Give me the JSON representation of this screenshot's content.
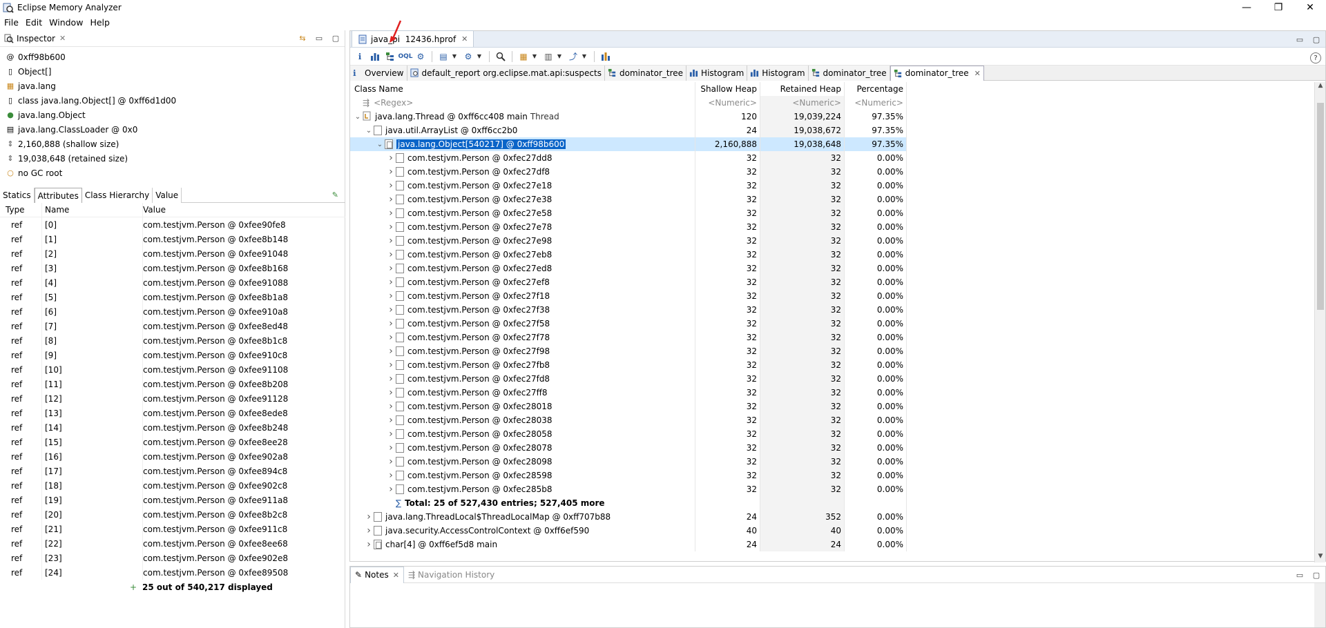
{
  "window": {
    "title": "Eclipse Memory Analyzer",
    "controls": [
      "—",
      "❐",
      "✕"
    ]
  },
  "menu": [
    "File",
    "Edit",
    "Window",
    "Help"
  ],
  "inspector": {
    "tab_label": "Inspector",
    "info": [
      {
        "icon": "at-icon",
        "glyph": "@",
        "text": "0xff98b600"
      },
      {
        "icon": "array-class-icon",
        "glyph": "▯",
        "text": "Object[]"
      },
      {
        "icon": "package-icon",
        "glyph": "▦",
        "text": "java.lang"
      },
      {
        "icon": "class-icon",
        "glyph": "▯",
        "text": "class java.lang.Object[] @ 0xff6d1d00"
      },
      {
        "icon": "superclass-icon",
        "glyph": "●",
        "text": "java.lang.Object"
      },
      {
        "icon": "classloader-icon",
        "glyph": "▤",
        "text": "java.lang.ClassLoader @ 0x0"
      },
      {
        "icon": "shallow-size-icon",
        "glyph": "⇕",
        "text": "2,160,888 (shallow size)"
      },
      {
        "icon": "retained-size-icon",
        "glyph": "⇕",
        "text": "19,038,648 (retained size)"
      },
      {
        "icon": "gc-root-icon",
        "glyph": "○",
        "text": "no GC root"
      }
    ],
    "tabs": [
      "Statics",
      "Attributes",
      "Class Hierarchy",
      "Value"
    ],
    "active_tab": "Attributes",
    "columns": [
      "Type",
      "Name",
      "Value"
    ],
    "rows": [
      {
        "type": "ref",
        "name": "[0]",
        "value": "com.testjvm.Person @ 0xfee90fe8"
      },
      {
        "type": "ref",
        "name": "[1]",
        "value": "com.testjvm.Person @ 0xfee8b148"
      },
      {
        "type": "ref",
        "name": "[2]",
        "value": "com.testjvm.Person @ 0xfee91048"
      },
      {
        "type": "ref",
        "name": "[3]",
        "value": "com.testjvm.Person @ 0xfee8b168"
      },
      {
        "type": "ref",
        "name": "[4]",
        "value": "com.testjvm.Person @ 0xfee91088"
      },
      {
        "type": "ref",
        "name": "[5]",
        "value": "com.testjvm.Person @ 0xfee8b1a8"
      },
      {
        "type": "ref",
        "name": "[6]",
        "value": "com.testjvm.Person @ 0xfee910a8"
      },
      {
        "type": "ref",
        "name": "[7]",
        "value": "com.testjvm.Person @ 0xfee8ed48"
      },
      {
        "type": "ref",
        "name": "[8]",
        "value": "com.testjvm.Person @ 0xfee8b1c8"
      },
      {
        "type": "ref",
        "name": "[9]",
        "value": "com.testjvm.Person @ 0xfee910c8"
      },
      {
        "type": "ref",
        "name": "[10]",
        "value": "com.testjvm.Person @ 0xfee91108"
      },
      {
        "type": "ref",
        "name": "[11]",
        "value": "com.testjvm.Person @ 0xfee8b208"
      },
      {
        "type": "ref",
        "name": "[12]",
        "value": "com.testjvm.Person @ 0xfee91128"
      },
      {
        "type": "ref",
        "name": "[13]",
        "value": "com.testjvm.Person @ 0xfee8ede8"
      },
      {
        "type": "ref",
        "name": "[14]",
        "value": "com.testjvm.Person @ 0xfee8b248"
      },
      {
        "type": "ref",
        "name": "[15]",
        "value": "com.testjvm.Person @ 0xfee8ee28"
      },
      {
        "type": "ref",
        "name": "[16]",
        "value": "com.testjvm.Person @ 0xfee902a8"
      },
      {
        "type": "ref",
        "name": "[17]",
        "value": "com.testjvm.Person @ 0xfee894c8"
      },
      {
        "type": "ref",
        "name": "[18]",
        "value": "com.testjvm.Person @ 0xfee902c8"
      },
      {
        "type": "ref",
        "name": "[19]",
        "value": "com.testjvm.Person @ 0xfee911a8"
      },
      {
        "type": "ref",
        "name": "[20]",
        "value": "com.testjvm.Person @ 0xfee8b2c8"
      },
      {
        "type": "ref",
        "name": "[21]",
        "value": "com.testjvm.Person @ 0xfee911c8"
      },
      {
        "type": "ref",
        "name": "[22]",
        "value": "com.testjvm.Person @ 0xfee8ee68"
      },
      {
        "type": "ref",
        "name": "[23]",
        "value": "com.testjvm.Person @ 0xfee902e8"
      },
      {
        "type": "ref",
        "name": "[24]",
        "value": "com.testjvm.Person @ 0xfee89508"
      }
    ],
    "footer": "25 out of 540,217 displayed"
  },
  "editor": {
    "tab_label": "java_pi  12436.hprof",
    "query_tabs": [
      {
        "label": "Overview",
        "icon": "info-icon"
      },
      {
        "label": "default_report  org.eclipse.mat.api:suspects",
        "icon": "report-icon"
      },
      {
        "label": "dominator_tree",
        "icon": "dominator-tree-icon"
      },
      {
        "label": "Histogram",
        "icon": "histogram-icon"
      },
      {
        "label": "Histogram",
        "icon": "histogram-icon"
      },
      {
        "label": "dominator_tree",
        "icon": "dominator-tree-icon"
      },
      {
        "label": "dominator_tree",
        "icon": "dominator-tree-icon",
        "active": true
      }
    ],
    "columns": {
      "name": "Class Name",
      "shallow": "Shallow Heap",
      "retained": "Retained Heap",
      "pct": "Percentage"
    },
    "filters": {
      "name": "<Regex>",
      "shallow": "<Numeric>",
      "retained": "<Numeric>",
      "pct": "<Numeric>"
    },
    "rows": [
      {
        "level": 0,
        "expand": "open",
        "icon": "thread",
        "name": "java.lang.Thread @ 0xff6cc408  main",
        "extra": "Thread",
        "shallow": "120",
        "retained": "19,039,224",
        "pct": "97.35%"
      },
      {
        "level": 1,
        "expand": "open",
        "icon": "obj",
        "name": "java.util.ArrayList @ 0xff6cc2b0",
        "shallow": "24",
        "retained": "19,038,672",
        "pct": "97.35%"
      },
      {
        "level": 2,
        "expand": "open",
        "icon": "arr",
        "name": "java.lang.Object[540217] @ 0xff98b600",
        "shallow": "2,160,888",
        "retained": "19,038,648",
        "pct": "97.35%",
        "selected": true
      },
      {
        "level": 3,
        "expand": "closed",
        "icon": "obj",
        "name": "com.testjvm.Person @ 0xfec27dd8",
        "shallow": "32",
        "retained": "32",
        "pct": "0.00%"
      },
      {
        "level": 3,
        "expand": "closed",
        "icon": "obj",
        "name": "com.testjvm.Person @ 0xfec27df8",
        "shallow": "32",
        "retained": "32",
        "pct": "0.00%"
      },
      {
        "level": 3,
        "expand": "closed",
        "icon": "obj",
        "name": "com.testjvm.Person @ 0xfec27e18",
        "shallow": "32",
        "retained": "32",
        "pct": "0.00%"
      },
      {
        "level": 3,
        "expand": "closed",
        "icon": "obj",
        "name": "com.testjvm.Person @ 0xfec27e38",
        "shallow": "32",
        "retained": "32",
        "pct": "0.00%"
      },
      {
        "level": 3,
        "expand": "closed",
        "icon": "obj",
        "name": "com.testjvm.Person @ 0xfec27e58",
        "shallow": "32",
        "retained": "32",
        "pct": "0.00%"
      },
      {
        "level": 3,
        "expand": "closed",
        "icon": "obj",
        "name": "com.testjvm.Person @ 0xfec27e78",
        "shallow": "32",
        "retained": "32",
        "pct": "0.00%"
      },
      {
        "level": 3,
        "expand": "closed",
        "icon": "obj",
        "name": "com.testjvm.Person @ 0xfec27e98",
        "shallow": "32",
        "retained": "32",
        "pct": "0.00%"
      },
      {
        "level": 3,
        "expand": "closed",
        "icon": "obj",
        "name": "com.testjvm.Person @ 0xfec27eb8",
        "shallow": "32",
        "retained": "32",
        "pct": "0.00%"
      },
      {
        "level": 3,
        "expand": "closed",
        "icon": "obj",
        "name": "com.testjvm.Person @ 0xfec27ed8",
        "shallow": "32",
        "retained": "32",
        "pct": "0.00%"
      },
      {
        "level": 3,
        "expand": "closed",
        "icon": "obj",
        "name": "com.testjvm.Person @ 0xfec27ef8",
        "shallow": "32",
        "retained": "32",
        "pct": "0.00%"
      },
      {
        "level": 3,
        "expand": "closed",
        "icon": "obj",
        "name": "com.testjvm.Person @ 0xfec27f18",
        "shallow": "32",
        "retained": "32",
        "pct": "0.00%"
      },
      {
        "level": 3,
        "expand": "closed",
        "icon": "obj",
        "name": "com.testjvm.Person @ 0xfec27f38",
        "shallow": "32",
        "retained": "32",
        "pct": "0.00%"
      },
      {
        "level": 3,
        "expand": "closed",
        "icon": "obj",
        "name": "com.testjvm.Person @ 0xfec27f58",
        "shallow": "32",
        "retained": "32",
        "pct": "0.00%"
      },
      {
        "level": 3,
        "expand": "closed",
        "icon": "obj",
        "name": "com.testjvm.Person @ 0xfec27f78",
        "shallow": "32",
        "retained": "32",
        "pct": "0.00%"
      },
      {
        "level": 3,
        "expand": "closed",
        "icon": "obj",
        "name": "com.testjvm.Person @ 0xfec27f98",
        "shallow": "32",
        "retained": "32",
        "pct": "0.00%"
      },
      {
        "level": 3,
        "expand": "closed",
        "icon": "obj",
        "name": "com.testjvm.Person @ 0xfec27fb8",
        "shallow": "32",
        "retained": "32",
        "pct": "0.00%"
      },
      {
        "level": 3,
        "expand": "closed",
        "icon": "obj",
        "name": "com.testjvm.Person @ 0xfec27fd8",
        "shallow": "32",
        "retained": "32",
        "pct": "0.00%"
      },
      {
        "level": 3,
        "expand": "closed",
        "icon": "obj",
        "name": "com.testjvm.Person @ 0xfec27ff8",
        "shallow": "32",
        "retained": "32",
        "pct": "0.00%"
      },
      {
        "level": 3,
        "expand": "closed",
        "icon": "obj",
        "name": "com.testjvm.Person @ 0xfec28018",
        "shallow": "32",
        "retained": "32",
        "pct": "0.00%"
      },
      {
        "level": 3,
        "expand": "closed",
        "icon": "obj",
        "name": "com.testjvm.Person @ 0xfec28038",
        "shallow": "32",
        "retained": "32",
        "pct": "0.00%"
      },
      {
        "level": 3,
        "expand": "closed",
        "icon": "obj",
        "name": "com.testjvm.Person @ 0xfec28058",
        "shallow": "32",
        "retained": "32",
        "pct": "0.00%"
      },
      {
        "level": 3,
        "expand": "closed",
        "icon": "obj",
        "name": "com.testjvm.Person @ 0xfec28078",
        "shallow": "32",
        "retained": "32",
        "pct": "0.00%"
      },
      {
        "level": 3,
        "expand": "closed",
        "icon": "obj",
        "name": "com.testjvm.Person @ 0xfec28098",
        "shallow": "32",
        "retained": "32",
        "pct": "0.00%"
      },
      {
        "level": 3,
        "expand": "closed",
        "icon": "obj",
        "name": "com.testjvm.Person @ 0xfec28598",
        "shallow": "32",
        "retained": "32",
        "pct": "0.00%"
      },
      {
        "level": 3,
        "expand": "closed",
        "icon": "obj",
        "name": "com.testjvm.Person @ 0xfec285b8",
        "shallow": "32",
        "retained": "32",
        "pct": "0.00%"
      },
      {
        "level": 3,
        "expand": "none",
        "icon": "sum",
        "name": "Total: 25 of 527,430 entries; 527,405 more",
        "shallow": "",
        "retained": "",
        "pct": "",
        "bold": true
      },
      {
        "level": 1,
        "expand": "closed",
        "icon": "obj",
        "name": "java.lang.ThreadLocal$ThreadLocalMap @ 0xff707b88",
        "shallow": "24",
        "retained": "352",
        "pct": "0.00%"
      },
      {
        "level": 1,
        "expand": "closed",
        "icon": "obj",
        "name": "java.security.AccessControlContext @ 0xff6ef590",
        "shallow": "40",
        "retained": "40",
        "pct": "0.00%"
      },
      {
        "level": 1,
        "expand": "closed",
        "icon": "arr",
        "name": "char[4] @ 0xff6ef5d8  main",
        "shallow": "24",
        "retained": "24",
        "pct": "0.00%"
      }
    ]
  },
  "notes": {
    "tabs": [
      "Notes",
      "Navigation History"
    ]
  },
  "colors": {
    "selection": "#0a64c8",
    "selection_row": "#cde8ff",
    "annotation_arrow": "#e02020"
  }
}
